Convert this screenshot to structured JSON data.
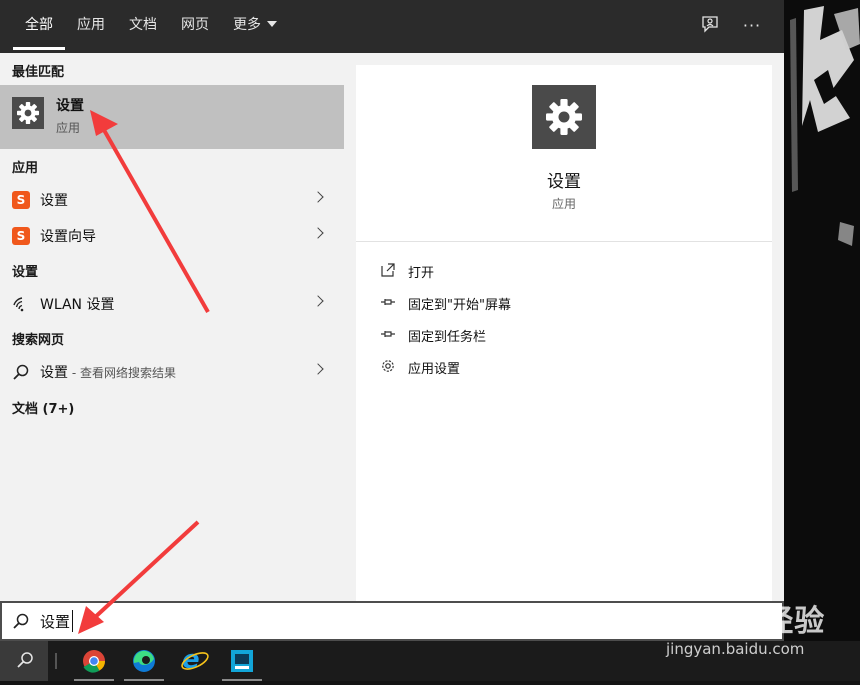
{
  "tabs": [
    {
      "label": "全部",
      "active": true
    },
    {
      "label": "应用"
    },
    {
      "label": "文档"
    },
    {
      "label": "网页"
    },
    {
      "label": "更多"
    }
  ],
  "toolbar_icons": [
    "feedback-icon",
    "more-options-icon"
  ],
  "toolbar_more_glyph": "···",
  "sections": {
    "best_match": "最佳匹配",
    "apps": "应用",
    "settings": "设置",
    "web": "搜索网页",
    "docs": "文档 (7+)"
  },
  "best_match": {
    "title": "设置",
    "subtitle": "应用",
    "icon": "gear-icon"
  },
  "apps": [
    {
      "label": "设置",
      "icon": "sogou-icon"
    },
    {
      "label": "设置向导",
      "icon": "sogou-icon"
    }
  ],
  "sogou_glyph": "S",
  "settings_items": [
    {
      "label": "WLAN 设置",
      "icon": "wifi-icon"
    }
  ],
  "web_result": {
    "label": "设置",
    "suffix": " - 查看网络搜索结果",
    "icon": "search-icon"
  },
  "detail": {
    "title": "设置",
    "subtitle": "应用",
    "actions": [
      {
        "label": "打开",
        "icon": "open-icon"
      },
      {
        "label": "固定到\"开始\"屏幕",
        "icon": "pin-icon"
      },
      {
        "label": "固定到任务栏",
        "icon": "pin-icon"
      },
      {
        "label": "应用设置",
        "icon": "gear-icon"
      }
    ]
  },
  "search": {
    "value": "设置"
  },
  "taskbar": {
    "apps": [
      "chrome-icon",
      "edge-icon",
      "ie-icon",
      "app-icon"
    ],
    "ie_glyph": "e"
  },
  "watermark": {
    "logo": "Baidu经验",
    "url": "jingyan.baidu.com"
  },
  "colors": {
    "accent_red": "#f23c3c",
    "sogou_orange": "#f0581c",
    "selected_row": "#c0c0c0",
    "tabbar_bg": "#2b2b2b"
  }
}
